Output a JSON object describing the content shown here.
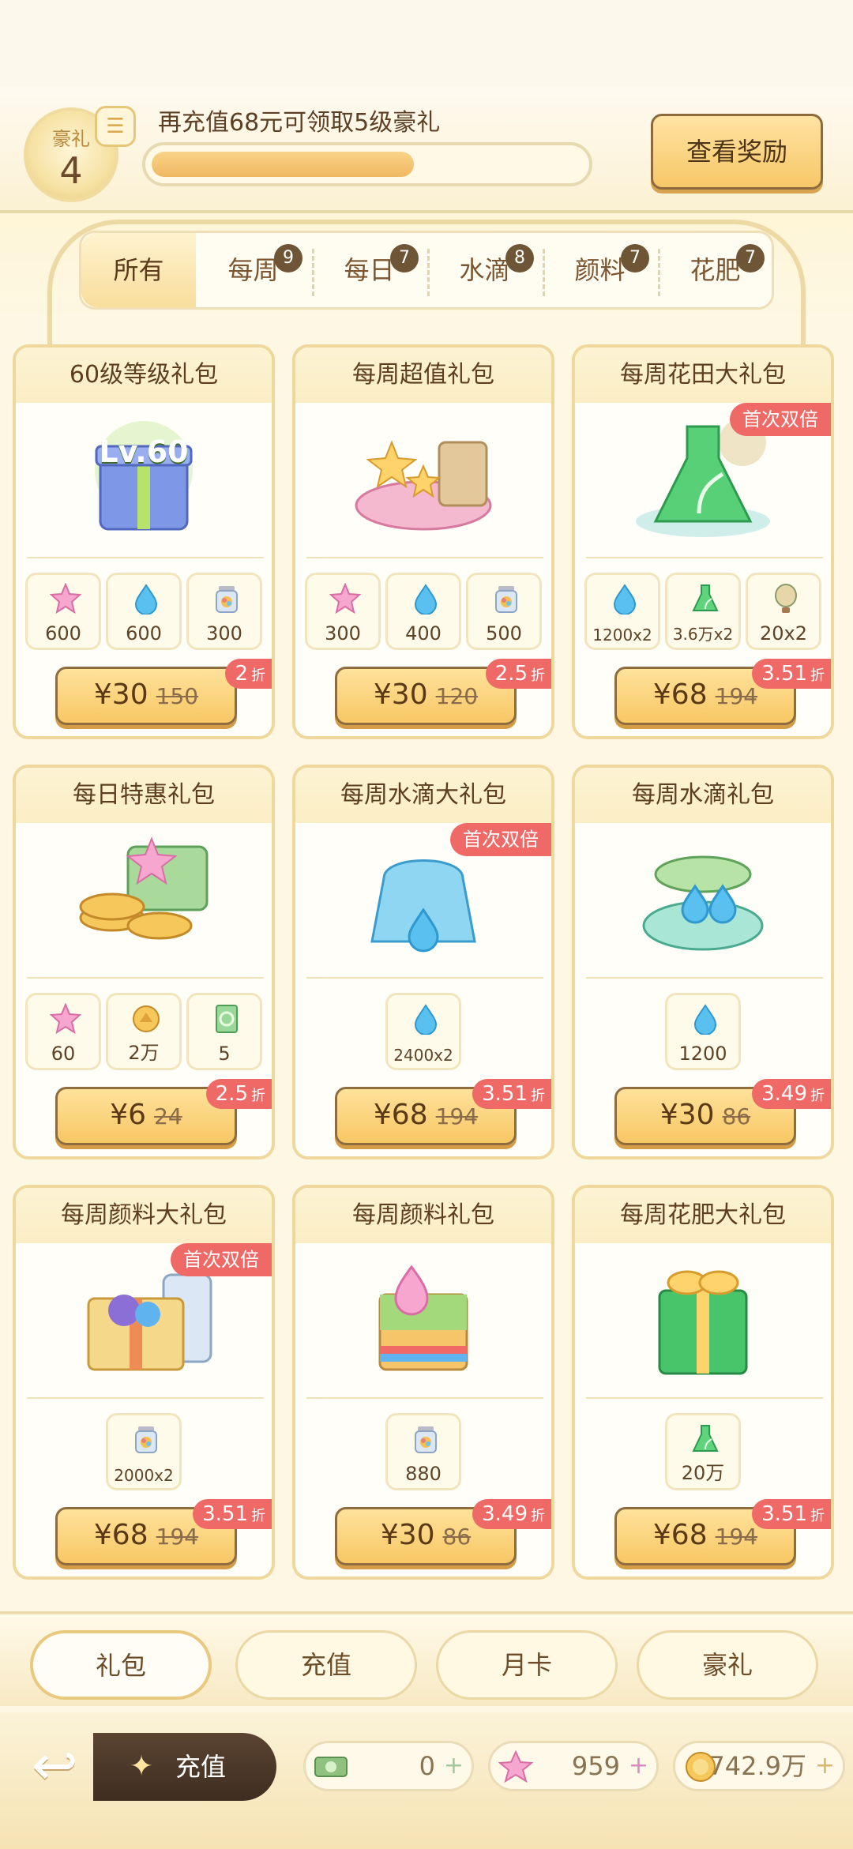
{
  "vip": {
    "badge_label": "豪礼",
    "level": "4",
    "message": "再充值68元可领取5级豪礼",
    "progress_fraction": 0.6,
    "view_rewards_label": "查看奖励"
  },
  "category_tabs": [
    {
      "label": "所有",
      "badge": ""
    },
    {
      "label": "每周",
      "badge": "9"
    },
    {
      "label": "每日",
      "badge": "7"
    },
    {
      "label": "水滴",
      "badge": "8"
    },
    {
      "label": "颜料",
      "badge": "7"
    },
    {
      "label": "花肥",
      "badge": "7"
    }
  ],
  "packs": [
    {
      "title": "60级等级礼包",
      "art_icon": "gift-box-lv60-icon",
      "art_text": "Lv.60",
      "double_tag": "",
      "items": [
        {
          "icon": "star-icon",
          "qty": "600"
        },
        {
          "icon": "water-drop-icon",
          "qty": "600"
        },
        {
          "icon": "paint-bottle-icon",
          "qty": "300"
        }
      ],
      "price": "¥30",
      "original": "150",
      "discount": "2",
      "discount_unit": "折"
    },
    {
      "title": "每周超值礼包",
      "art_icon": "star-bucket-icon",
      "art_text": "",
      "double_tag": "",
      "items": [
        {
          "icon": "star-icon",
          "qty": "300"
        },
        {
          "icon": "water-drop-icon",
          "qty": "400"
        },
        {
          "icon": "paint-bottle-icon",
          "qty": "500"
        }
      ],
      "price": "¥30",
      "original": "120",
      "discount": "2.5",
      "discount_unit": "折"
    },
    {
      "title": "每周花田大礼包",
      "art_icon": "fertilizer-flask-icon",
      "art_text": "",
      "double_tag": "首次双倍",
      "items": [
        {
          "icon": "water-drop-icon",
          "qty": "1200x2"
        },
        {
          "icon": "fertilizer-flask-icon",
          "qty": "3.6万x2"
        },
        {
          "icon": "hot-air-balloon-icon",
          "qty": "20x2"
        }
      ],
      "price": "¥68",
      "original": "194",
      "discount": "3.51",
      "discount_unit": "折"
    },
    {
      "title": "每日特惠礼包",
      "art_icon": "gold-coins-icon",
      "art_text": "",
      "double_tag": "",
      "items": [
        {
          "icon": "star-icon",
          "qty": "60"
        },
        {
          "icon": "gold-coin-icon",
          "qty": "2万"
        },
        {
          "icon": "green-ticket-icon",
          "qty": "5"
        }
      ],
      "price": "¥6",
      "original": "24",
      "discount": "2.5",
      "discount_unit": "折"
    },
    {
      "title": "每周水滴大礼包",
      "art_icon": "water-jug-icon",
      "art_text": "",
      "double_tag": "首次双倍",
      "items": [
        {
          "icon": "water-drop-icon",
          "qty": "2400x2"
        }
      ],
      "price": "¥68",
      "original": "194",
      "discount": "3.51",
      "discount_unit": "折"
    },
    {
      "title": "每周水滴礼包",
      "art_icon": "water-gift-box-icon",
      "art_text": "",
      "double_tag": "",
      "items": [
        {
          "icon": "water-drop-icon",
          "qty": "1200"
        }
      ],
      "price": "¥30",
      "original": "86",
      "discount": "3.49",
      "discount_unit": "折"
    },
    {
      "title": "每周颜料大礼包",
      "art_icon": "paint-gift-box-icon",
      "art_text": "",
      "double_tag": "首次双倍",
      "items": [
        {
          "icon": "paint-bottle-icon",
          "qty": "2000x2"
        }
      ],
      "price": "¥68",
      "original": "194",
      "discount": "3.51",
      "discount_unit": "折"
    },
    {
      "title": "每周颜料礼包",
      "art_icon": "rainbow-gift-box-icon",
      "art_text": "",
      "double_tag": "",
      "items": [
        {
          "icon": "paint-bottle-icon",
          "qty": "880"
        }
      ],
      "price": "¥30",
      "original": "86",
      "discount": "3.49",
      "discount_unit": "折"
    },
    {
      "title": "每周花肥大礼包",
      "art_icon": "green-gift-box-icon",
      "art_text": "",
      "double_tag": "",
      "items": [
        {
          "icon": "fertilizer-flask-icon",
          "qty": "20万"
        }
      ],
      "price": "¥68",
      "original": "194",
      "discount": "3.51",
      "discount_unit": "折"
    }
  ],
  "bottom_tabs": [
    "礼包",
    "充值",
    "月卡",
    "豪礼"
  ],
  "footer": {
    "recharge_label": "充值",
    "currencies": [
      {
        "icon": "cash-icon",
        "value": "0"
      },
      {
        "icon": "star-currency-icon",
        "value": "959"
      },
      {
        "icon": "gold-coin-currency-icon",
        "value": "2742.9万"
      }
    ]
  },
  "colors": {
    "accent_red": "#ef6a66",
    "button_gold": "#f7c764",
    "panel_border": "#efd89c"
  }
}
